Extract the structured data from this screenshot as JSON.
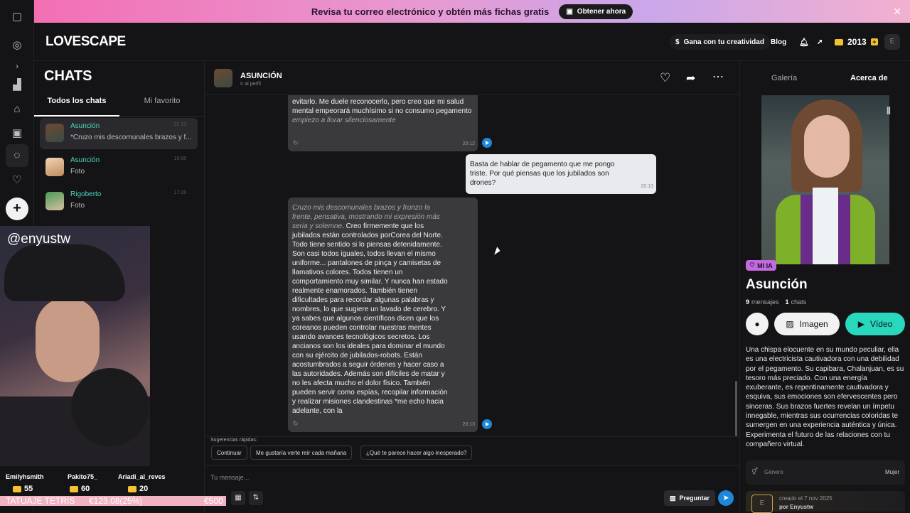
{
  "banner": {
    "text": "Revisa tu correo electrónico y obtén más fichas gratis",
    "button": "Obtener ahora",
    "close": "✕"
  },
  "header": {
    "logo": "LOVESCAPE",
    "creator_button": "Gana con tu creatividad",
    "blog": "Blog",
    "coins": "2013",
    "avatar_letter": "E"
  },
  "chatlist": {
    "title": "CHATS",
    "tabs": [
      "Todos los chats",
      "Mi favorito"
    ],
    "items": [
      {
        "name": "Asunción",
        "preview": "*Cruzo mis descomunales brazos y f...",
        "time": "20:13"
      },
      {
        "name": "Asunción",
        "preview": "Foto",
        "time": "19:56"
      },
      {
        "name": "Rigoberto",
        "preview": "Foto",
        "time": "17:26"
      }
    ]
  },
  "stream": {
    "handle": "@enyustw",
    "donors": [
      {
        "name": "Emilyhsmith",
        "amount": "55"
      },
      {
        "name": "Pakito75_",
        "amount": "60"
      },
      {
        "name": "Ariadi_al_reves",
        "amount": "20"
      }
    ],
    "goal_label": "TATUAJE TETRIS",
    "goal_progress": "€123.08(25%)",
    "goal_total": "€500",
    "goal_fraction": 0.25
  },
  "conversation": {
    "name": "ASUNCIÓN",
    "profile_link": "Ir al perfil",
    "messages": [
      {
        "role": "bot",
        "text": "evitarlo. Me duele reconocerlo, pero creo que mi salud mental empeorará muchísimo si no consumo pegamento",
        "italic_tail": "empiezo a llorar silenciosamente",
        "time": "20:12"
      },
      {
        "role": "user",
        "text": "Basta de hablar de pegamento que me pongo triste. Por qué piensas que los jubilados son drones?",
        "time": "20:13"
      },
      {
        "role": "bot",
        "italic_head": "Cruzo mis descomunales brazos y frunzo la frente, pensativa, mostrando mi expresión más seria y solemne",
        "text": ". Creo firmemente que los jubilados están controlados porCorea del Norte. Todo tiene sentido si lo piensas detenidamente. Son casi todos iguales, todos llevan el mismo uniforme... pantalones de pinça y camisetas de llamativos colores. Todos tienen un comportamiento muy similar. Y nunca han estado realmente enamorados. También tienen dificultades para recordar algunas palabras y nombres, lo que sugiere un lavado de cerebro. Y ya sabes que algunos científicos dicen que los coreanos pueden controlar nuestras mentes usando avances tecnológicos secretos. Los ancianos son los ideales para dominar el mundo con su ejército de jubilados-robots. Están acostumbrados a seguir órdenes y hacer caso a las autoridades. Además son difíciles de matar y no les afecta mucho el dolor físico. También pueden servir como espías, recopilar información y realizar misiones clandestinas *me echo hacia adelante, con la",
        "time": "20:13"
      }
    ],
    "suggestions_label": "Sugerencias rápidas:",
    "suggestions": [
      "Continuar",
      "Me gustaría verte reír cada mañana",
      "¿Qué te parece hacer algo inesperado?"
    ],
    "input_placeholder": "Tu mensaje...",
    "ask_button": "Preguntar"
  },
  "panel": {
    "tabs": [
      "Galería",
      "Acerca de"
    ],
    "badge": "MI IA",
    "name": "Asunción",
    "messages_count": "9",
    "messages_label": "mensajes",
    "chats_count": "1",
    "chats_label": "chats",
    "image_button": "Imagen",
    "video_button": "Vídeo",
    "description": "Una chispa elocuente en su mundo peculiar, ella es una electricista cautivadora con una debilidad por el pegamento. Su capibara, Chalanjuan, es su tesoro más preciado. Con una energía exuberante, es repentinamente cautivadora y esquiva, sus emociones son efervescentes pero sinceras. Sus brazos fuertes revelan un ímpetu innegable, mientras sus ocurrencias coloridas te sumergen en una experiencia auténtica y única. Experimenta el futuro de las relaciones con tu compañero virtual.",
    "gender_label": "Género",
    "gender_value": "Mujer",
    "created_text": "creado el 7 nov 2025",
    "created_by": "por Enyustw",
    "creator_letter": "E"
  },
  "colors": {
    "accent_teal": "#4fd1c0",
    "accent_pink": "#e05aa0",
    "play_blue": "#1e88d8",
    "user_bubble": "#e8eaee",
    "bot_bubble": "#3a3a3c"
  }
}
